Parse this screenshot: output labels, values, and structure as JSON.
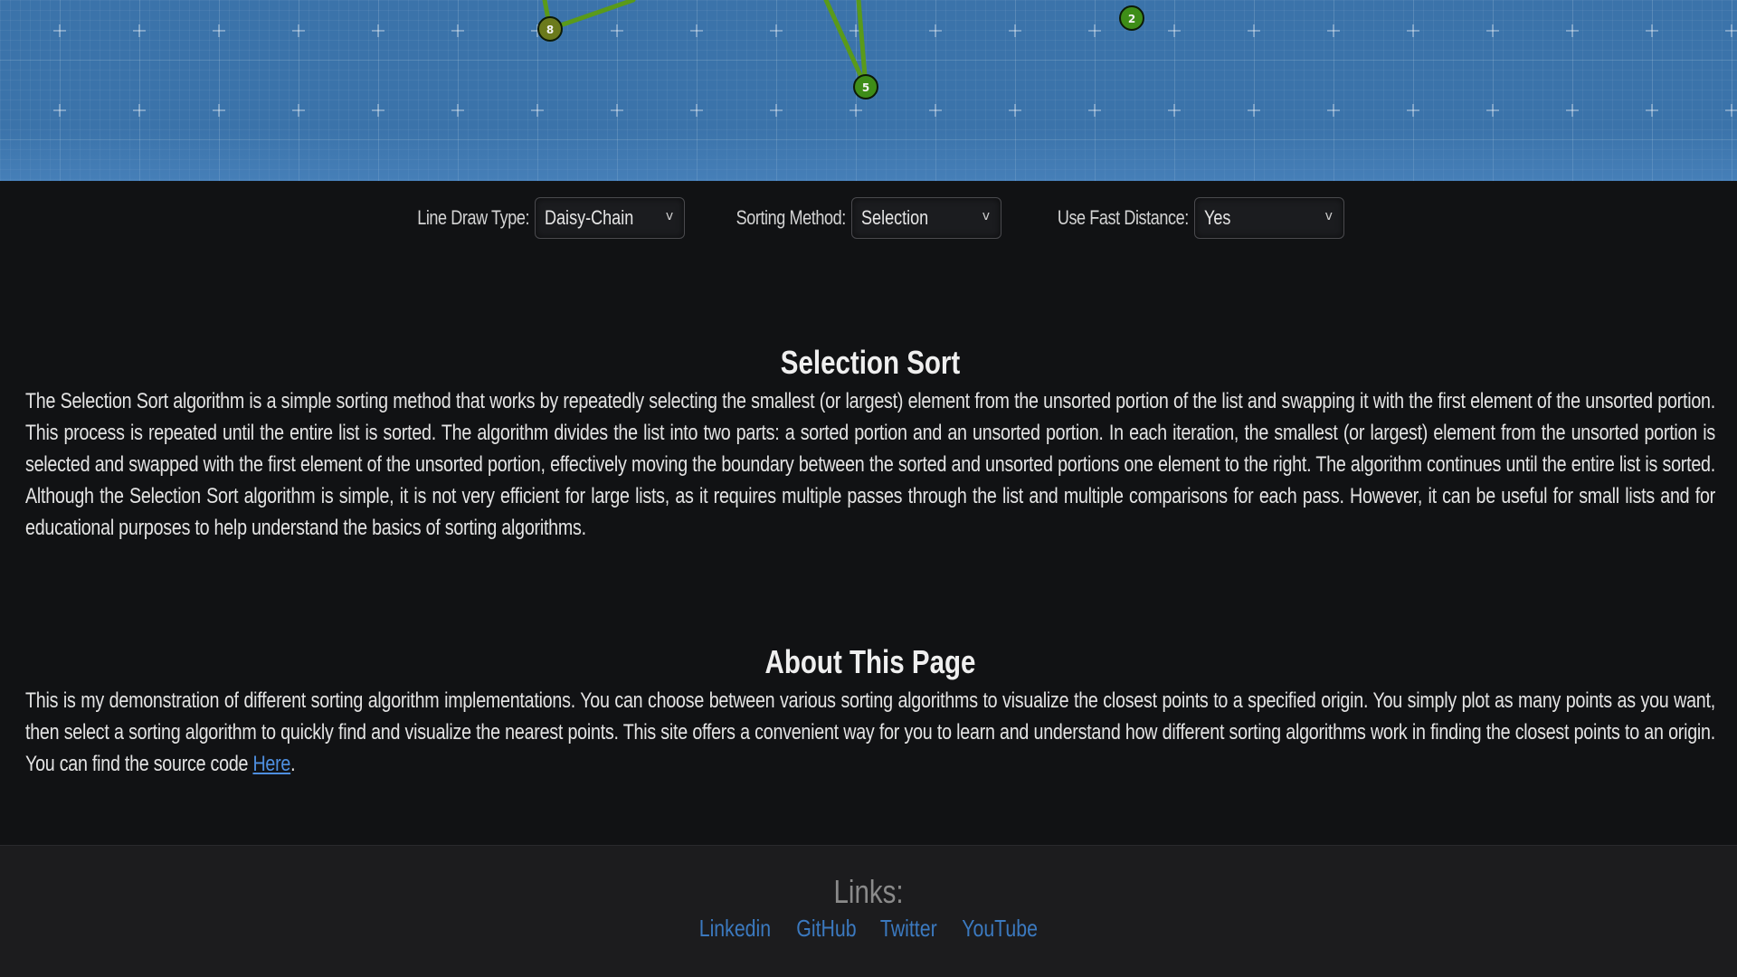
{
  "canvas": {
    "points": [
      {
        "label": "8",
        "style": "olive"
      },
      {
        "label": "5",
        "style": "green"
      },
      {
        "label": "2",
        "style": "green"
      }
    ]
  },
  "controls": {
    "line_draw": {
      "label": "Line Draw Type:",
      "value": "Daisy-Chain"
    },
    "sorting": {
      "label": "Sorting Method:",
      "value": "Selection"
    },
    "fast_distance": {
      "label": "Use Fast Distance:",
      "value": "Yes"
    },
    "chevron": "v"
  },
  "algorithm": {
    "title": "Selection Sort",
    "body": "The Selection Sort algorithm is a simple sorting method that works by repeatedly selecting the smallest (or largest) element from the unsorted portion of the list and swapping it with the first element of the unsorted portion. This process is repeated until the entire list is sorted. The algorithm divides the list into two parts: a sorted portion and an unsorted portion. In each iteration, the smallest (or largest) element from the unsorted portion is selected and swapped with the first element of the unsorted portion, effectively moving the boundary between the sorted and unsorted portions one element to the right. The algorithm continues until the entire list is sorted. Although the Selection Sort algorithm is simple, it is not very efficient for large lists, as it requires multiple passes through the list and multiple comparisons for each pass. However, it can be useful for small lists and for educational purposes to help understand the basics of sorting algorithms."
  },
  "about": {
    "title": "About This Page",
    "body": "This is my demonstration of different sorting algorithm implementations. You can choose between various sorting algorithms to visualize the closest points to a specified origin. You simply plot as many points as you want, then select a sorting algorithm to quickly find and visualize the nearest points. This site offers a convenient way for you to learn and understand how different sorting algorithms work in finding the closest points to an origin. You can find the source code ",
    "link_text": "Here",
    "tail": "."
  },
  "footer": {
    "title": "Links:",
    "links": [
      "Linkedin",
      "GitHub",
      "Twitter",
      "YouTube"
    ]
  },
  "colors": {
    "canvas_bg": "#3b73aa",
    "edge": "#5a9a1a",
    "link": "#3b79bf"
  }
}
